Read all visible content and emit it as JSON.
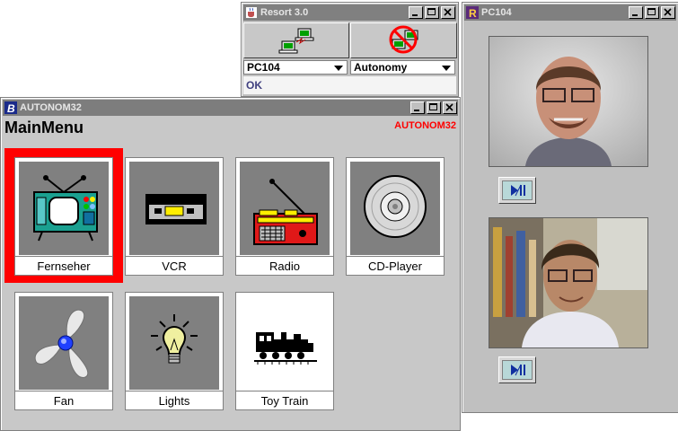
{
  "resort": {
    "title": "Resort 3.0",
    "pc_select": "PC104",
    "mode_select": "Autonomy",
    "status": "OK"
  },
  "autonom": {
    "title": "AUTONOM32",
    "header": "MainMenu",
    "tag": "AUTONOM32",
    "tiles": [
      {
        "label": "Fernseher",
        "icon": "tv-icon"
      },
      {
        "label": "VCR",
        "icon": "vcr-icon"
      },
      {
        "label": "Radio",
        "icon": "radio-icon"
      },
      {
        "label": "CD-Player",
        "icon": "cd-icon"
      },
      {
        "label": "Fan",
        "icon": "fan-icon"
      },
      {
        "label": "Lights",
        "icon": "lightbulb-icon"
      },
      {
        "label": "Toy Train",
        "icon": "train-icon"
      }
    ],
    "selected": "Fernseher",
    "highlight_color": "#ff0000"
  },
  "pc104": {
    "title": "PC104"
  }
}
